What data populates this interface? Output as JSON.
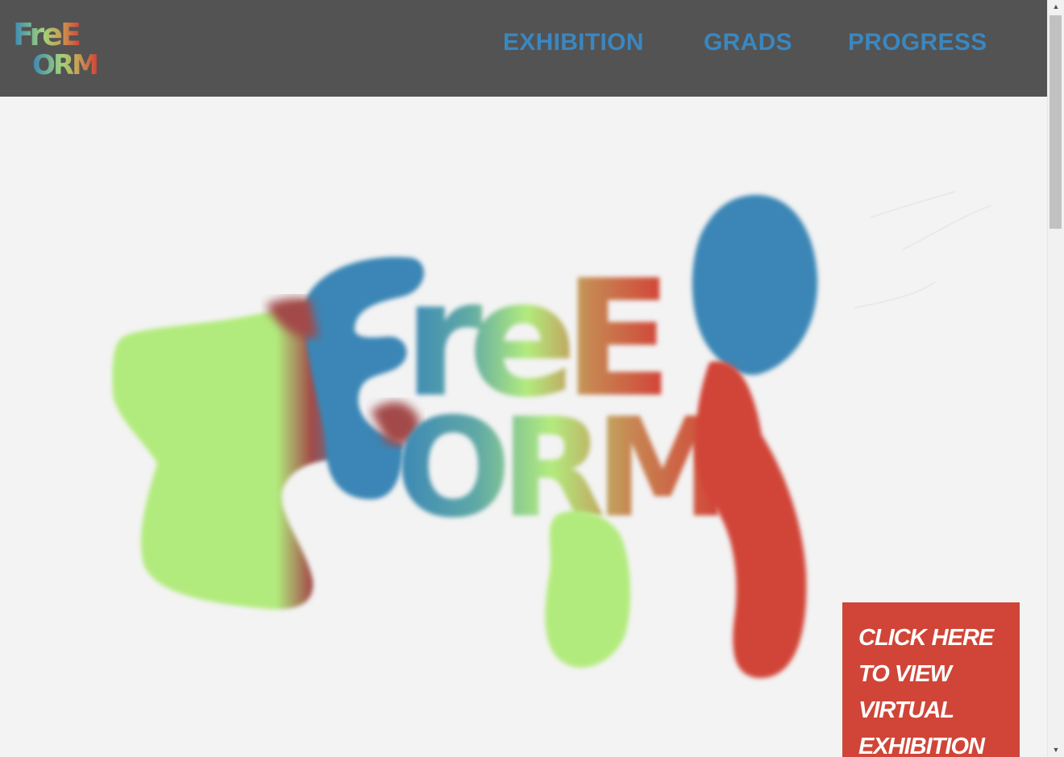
{
  "header": {
    "logo": {
      "alt": "Free Form logo",
      "line1": "FreE",
      "line2": "ORM"
    },
    "nav": [
      {
        "label": "EXHIBITION"
      },
      {
        "label": "GRADS"
      },
      {
        "label": "PROGRESS"
      }
    ]
  },
  "hero": {
    "artwork_name": "freeform-blob-lettering",
    "artwork_text": "FreE FORM",
    "colors": {
      "green": "#b2eb7d",
      "blue": "#3a86b6",
      "red": "#d14538",
      "orange": "#c78853",
      "teal": "#5fa8a6"
    }
  },
  "cta": {
    "lines": [
      "CLICK HERE",
      "TO VIEW",
      "VIRTUAL",
      "EXHIBITION"
    ]
  },
  "scrollbar": {
    "up_icon": "triangle-up-icon",
    "down_icon": "triangle-down-icon"
  },
  "theme": {
    "header_bg": "#535353",
    "nav_color": "#3a87c0",
    "page_bg": "#f3f3f3",
    "cta_bg": "#d04537"
  }
}
